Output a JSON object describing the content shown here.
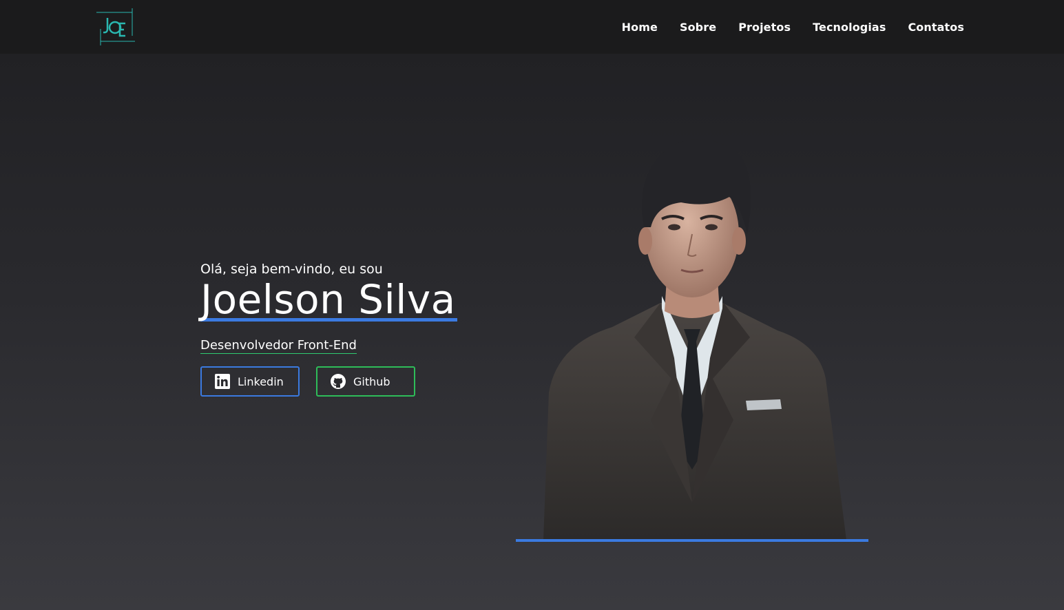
{
  "header": {
    "logo_alt": "JOE logo",
    "nav": [
      {
        "label": "Home"
      },
      {
        "label": "Sobre"
      },
      {
        "label": "Projetos"
      },
      {
        "label": "Tecnologias"
      },
      {
        "label": "Contatos"
      }
    ]
  },
  "hero": {
    "greeting": "Olá, seja bem-vindo, eu sou",
    "name": "Joelson Silva",
    "role": "Desenvolvedor Front-End",
    "buttons": {
      "linkedin": {
        "label": "Linkedin",
        "icon": "linkedin-icon"
      },
      "github": {
        "label": "Github",
        "icon": "github-icon"
      }
    }
  },
  "colors": {
    "accent_blue": "#3b7ae0",
    "accent_green": "#2ebd59",
    "logo_teal": "#2ab7b0",
    "header_bg": "#1b1b1c"
  }
}
